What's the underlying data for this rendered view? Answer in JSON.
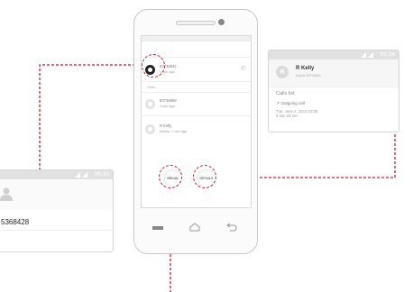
{
  "phone": {
    "call_log": [
      {
        "title": "83736842",
        "subtitle": "1 min ago"
      },
      {
        "title": "83736859",
        "subtitle": "1 min ago"
      },
      {
        "title": "R Kelly",
        "subtitle": "Mobile, 2 min ago"
      }
    ],
    "section_label": "Older",
    "buttons": {
      "redial": "REDIAL",
      "details": "DETAILS"
    }
  },
  "left_callout": {
    "time": "06:34",
    "number": "5368428"
  },
  "right_callout": {
    "time": "06:34",
    "avatar_letter": "R",
    "name": "R Kelly",
    "subtitle": "Mobile 83736842",
    "section_title": "Calls list",
    "call_type": "Outgoing call",
    "date_line": "Tue, June 4, 2013 23:35",
    "duration_line": "0 min 15 sec"
  },
  "colors": {
    "highlight": "#d21b2c",
    "panel_bar": "#e1e1e1"
  },
  "icons": {
    "avatar": "person-icon",
    "call": "phone-icon",
    "outgoing": "outgoing-arrow-icon"
  }
}
